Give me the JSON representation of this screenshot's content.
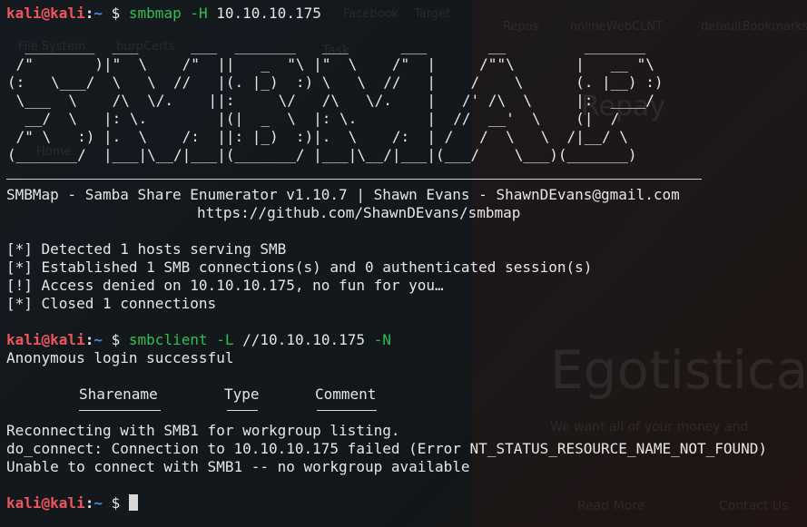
{
  "prompt": {
    "user_host": "kali@kali",
    "colon": ":",
    "path": "~",
    "dollar": "$"
  },
  "cmd1": {
    "name": "smbmap",
    "flag": "-H",
    "arg": "10.10.10.175"
  },
  "banner_art": [
    "  ________  ___      ___  _______   ___      ___       __         _______",
    " /\"       )|\"  \\    /\"  ||   _  \"\\ |\"  \\    /\"  |     /\"\"\\       |   __ \"\\",
    "(:   \\___/  \\   \\  //   |(. |_)  :) \\   \\  //   |    /    \\      (. |__) :)",
    " \\___  \\    /\\  \\/.    ||:     \\/   /\\   \\/.    |   /' /\\  \\     |:  ____/",
    "  __/  \\   |: \\.        |(|  _  \\  |: \\.        |  //  __'  \\    (|  /",
    " /\" \\   :) |.  \\    /:  ||: |_)  :)|.  \\    /:  | /   /  \\   \\  /|__/ \\",
    "(_______/  |___|\\__/|___|(_______/ |___|\\__/|___|(___/    \\___)(_______)"
  ],
  "banner_line1": "SMBMap - Samba Share Enumerator v1.10.7 | Shawn Evans - ShawnDEvans@gmail.com",
  "banner_line2": "https://github.com/ShawnDEvans/smbmap",
  "output1": [
    "[*] Detected 1 hosts serving SMB",
    "[*] Established 1 SMB connections(s) and 0 authenticated session(s)",
    "[!] Access denied on 10.10.10.175, no fun for you…",
    "[*] Closed 1 connections"
  ],
  "cmd2": {
    "name": "smbclient",
    "flag1": "-L",
    "arg": "//10.10.10.175",
    "flag2": "-N"
  },
  "anon_login": "Anonymous login successful",
  "share_header": {
    "name": "Sharename",
    "type": "Type",
    "comment": "Comment"
  },
  "output2": [
    "Reconnecting with SMB1 for workgroup listing.",
    "do_connect: Connection to 10.10.10.175 failed (Error NT_STATUS_RESOURCE_NAME_NOT_FOUND)",
    "Unable to connect with SMB1 -- no workgroup available"
  ],
  "background": {
    "tab_a": "Facebook",
    "tab_b": "Target",
    "bookmark_1": "Repos",
    "bookmark_2": "onlineWebCLNT",
    "bookmark_3": "defaultBookmarks",
    "desk_fs": "File System",
    "desk_burp": "burpCerts",
    "desk_task": "Task",
    "desk_home": "Home",
    "repay": "Repay",
    "site_title": "Egotistica",
    "site_tagline": "We want all of your money and",
    "btn_read": "Read More",
    "btn_contact": "Contact Us"
  }
}
